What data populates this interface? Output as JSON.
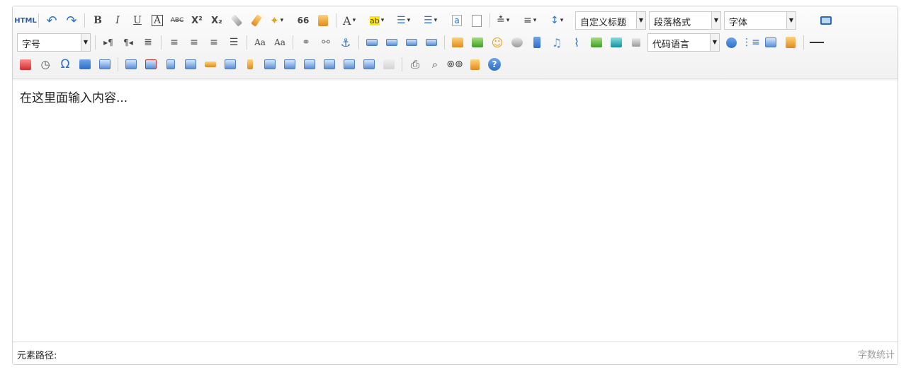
{
  "toolbar": {
    "html_label": "HTML",
    "bold": "B",
    "italic": "I",
    "underline": "U",
    "border": "A",
    "strike": "ABC",
    "sup": "X²",
    "sub": "X₂",
    "quote": "66",
    "font_color": "A",
    "highlight": "ab",
    "custom_heading": "自定义标题",
    "paragraph": "段落格式",
    "font_family": "字体",
    "font_size": "字号",
    "code_language": "代码语言",
    "help": "?",
    "omega": "Ω",
    "special_text": "Aa"
  },
  "editor": {
    "placeholder_content": "在这里面输入内容..."
  },
  "statusbar": {
    "path_label": "元素路径:",
    "word_count_label": "字数统计"
  },
  "icons": [
    "html-icon",
    "undo-icon",
    "redo-icon",
    "bold-icon",
    "italic-icon",
    "underline-icon",
    "fontborder-icon",
    "strikethrough-icon",
    "superscript-icon",
    "subscript-icon",
    "eraser-icon",
    "format-brush-icon",
    "autotypeset-icon",
    "blockquote-icon",
    "paste-text-icon",
    "fontcolor-icon",
    "backcolor-icon",
    "ordered-list-icon",
    "unordered-list-icon",
    "select-all-icon",
    "cleardoc-icon",
    "rowspacingtop-icon",
    "rowspacingbottom-icon",
    "lineheight-icon",
    "fullscreen-icon"
  ]
}
